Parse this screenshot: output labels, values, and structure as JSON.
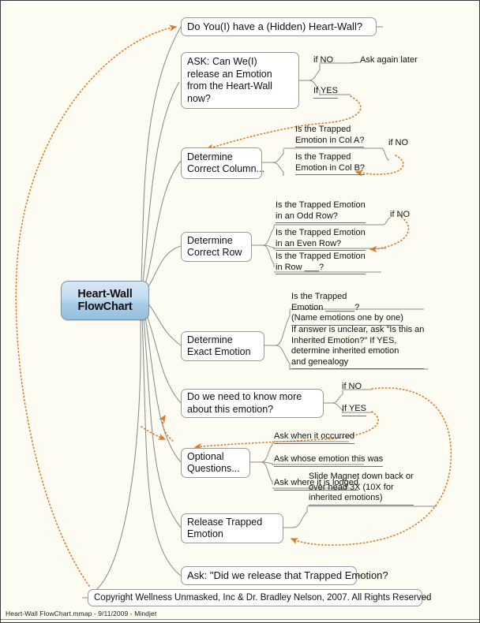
{
  "document": {
    "title": "Heart-Wall FlowChart",
    "footer": "Heart-Wall FlowChart.mmap - 9/11/2009 - Mindjet",
    "background_color": "#FDFCF2",
    "central_node_color": "#a8cbe6",
    "relationship_color": "#E0772B",
    "branch_color": "#8c8c8c"
  },
  "central": {
    "line1": "Heart-Wall",
    "line2": "FlowChart"
  },
  "topics": {
    "do_you_have": {
      "text": "Do You(I) have a (Hidden) Heart-Wall?"
    },
    "ask_release": {
      "line1": "ASK: Can We(I)",
      "line2": "release an Emotion",
      "line3": "from the Heart-Wall",
      "line4": "now?",
      "branches": {
        "if_no": "if NO",
        "if_yes": "If YES",
        "ask_again": "Ask again later"
      }
    },
    "determine_column": {
      "line1": "Determine",
      "line2": "Correct Column...",
      "leaves": [
        {
          "line1": "Is the Trapped",
          "line2": "Emotion in Col A?"
        },
        {
          "line1": "Is the Trapped",
          "line2": "Emotion in Col B?"
        }
      ],
      "if_no": "if NO"
    },
    "determine_row": {
      "line1": "Determine",
      "line2": "Correct Row",
      "leaves": [
        {
          "line1": "Is the Trapped Emotion",
          "line2": "in an Odd Row?"
        },
        {
          "line1": "Is the Trapped Emotion",
          "line2": "in an Even Row?"
        },
        {
          "line1": "Is the Trapped  Emotion",
          "line2": "in Row ___?"
        }
      ],
      "if_no": "if NO"
    },
    "determine_emotion": {
      "line1": "Determine",
      "line2": "Exact Emotion",
      "leaves": [
        {
          "line1": "Is the Trapped",
          "line2": "Emotion ______?",
          "line3": "(Name emotions one by one)"
        },
        {
          "line1": "If answer is unclear, ask \"Is this an",
          "line2": "Inherited Emotion?\" If YES,",
          "line3": "determine  inherited  emotion",
          "line4": "and  genealogy"
        }
      ]
    },
    "need_to_know_more": {
      "line1": "Do we need to know more",
      "line2": "about this emotion?",
      "branches": {
        "if_no": "if NO",
        "if_yes": "If YES"
      }
    },
    "optional_questions": {
      "line1": "Optional",
      "line2": "Questions...",
      "leaves": [
        "Ask when it occurred",
        "Ask whose emotion this was",
        "Ask where it is lodged"
      ]
    },
    "release_trapped": {
      "line1": "Release  Trapped",
      "line2": "Emotion",
      "leaves": [
        {
          "line1": "Slide Magnet down back or",
          "line2": "over head 3X (10X for",
          "line3": "inherited emotions)"
        }
      ]
    },
    "ask_did_we_release": {
      "text": "Ask: \"Did we release that Trapped Emotion?"
    },
    "copyright": {
      "text": "Copyright Wellness Unmasked, Inc & Dr. Bradley Nelson, 2007. All Rights Reserved"
    }
  }
}
